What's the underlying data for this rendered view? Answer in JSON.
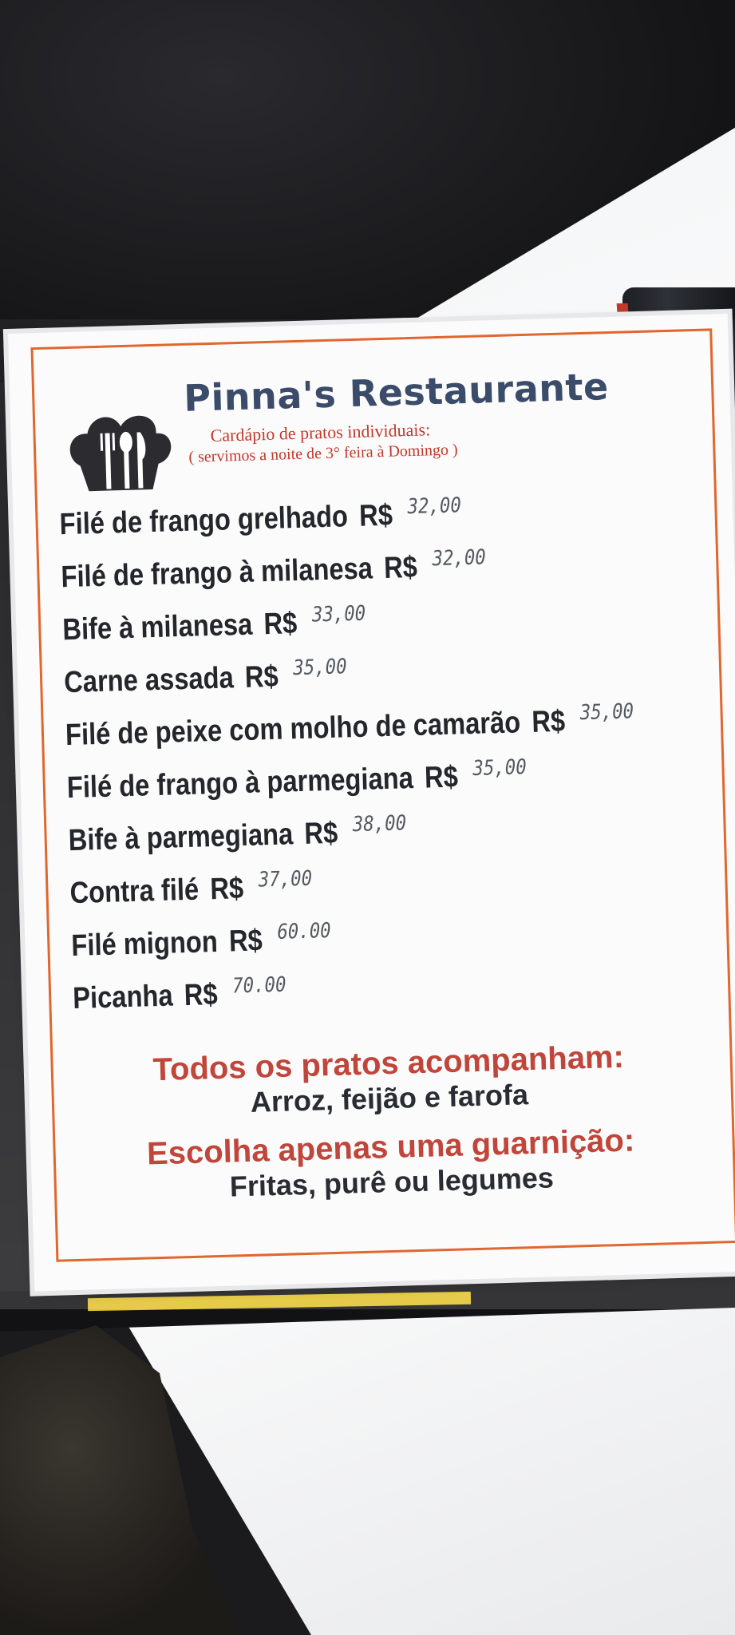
{
  "menu": {
    "title": "Pinna's Restaurante",
    "subtitle": "Cardápio de pratos individuais:",
    "note": "( servimos a noite de 3° feira à Domingo )",
    "logo_icon": "chef-hat-fork-spoon-knife-icon",
    "items": [
      {
        "name": "Filé de frango grelhado",
        "currency": "R$",
        "price": "32,00"
      },
      {
        "name": "Filé de frango à milanesa",
        "currency": "R$",
        "price": "32,00"
      },
      {
        "name": "Bife à milanesa",
        "currency": "R$",
        "price": "33,00"
      },
      {
        "name": "Carne assada",
        "currency": "R$",
        "price": "35,00"
      },
      {
        "name": "Filé de peixe com molho de camarão",
        "currency": "R$",
        "price": "35,00"
      },
      {
        "name": "Filé de frango à parmegiana",
        "currency": "R$",
        "price": "35,00"
      },
      {
        "name": "Bife à parmegiana",
        "currency": "R$",
        "price": "38,00"
      },
      {
        "name": "Contra filé",
        "currency": "R$",
        "price": "37,00"
      },
      {
        "name": "Filé mignon",
        "currency": "R$",
        "price": "60.00"
      },
      {
        "name": "Picanha",
        "currency": "R$",
        "price": "70.00"
      }
    ],
    "sides_heading": "Todos os pratos acompanham:",
    "sides_text": "Arroz, feijão e farofa",
    "garnish_heading": "Escolha apenas uma guarnição:",
    "garnish_text": "Fritas, purê ou legumes"
  },
  "colors": {
    "title": "#3b4b6a",
    "accent_red": "#c0392b",
    "border_orange": "#e0672e",
    "item_text": "#24262c"
  }
}
